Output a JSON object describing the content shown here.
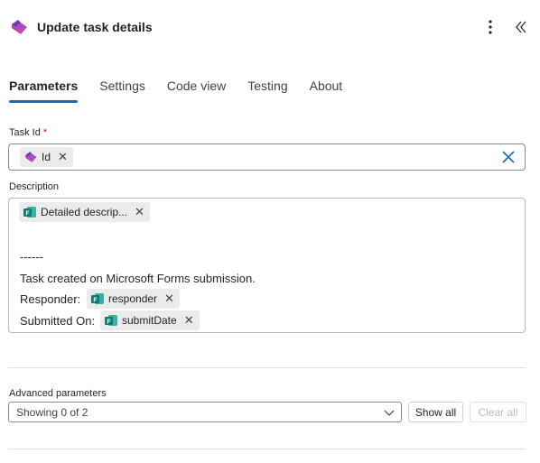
{
  "header": {
    "title": "Update task details",
    "more_icon": "more-vertical-icon",
    "collapse_icon": "double-chevron-left-icon"
  },
  "tabs": [
    {
      "label": "Parameters",
      "active": true
    },
    {
      "label": "Settings",
      "active": false
    },
    {
      "label": "Code view",
      "active": false
    },
    {
      "label": "Testing",
      "active": false
    },
    {
      "label": "About",
      "active": false
    }
  ],
  "task_id": {
    "label": "Task Id",
    "required_mark": "*",
    "token": {
      "label": "Id",
      "icon": "planner-icon"
    }
  },
  "description": {
    "label": "Description",
    "token_detailed": {
      "label": "Detailed descrip...",
      "icon": "forms-icon"
    },
    "separator": "------",
    "line_created": "Task created on Microsoft Forms submission.",
    "responder_label": "Responder:",
    "token_responder": {
      "label": "responder",
      "icon": "forms-icon"
    },
    "submitted_label": "Submitted On:",
    "token_submitdate": {
      "label": "submitDate",
      "icon": "forms-icon"
    }
  },
  "advanced": {
    "label": "Advanced parameters",
    "select_value": "Showing 0 of 2",
    "show_all": "Show all",
    "clear_all": "Clear all"
  },
  "colors": {
    "accent": "#0f6cbd",
    "required": "#c50f1f",
    "forms_green": "#0b7b6f"
  }
}
